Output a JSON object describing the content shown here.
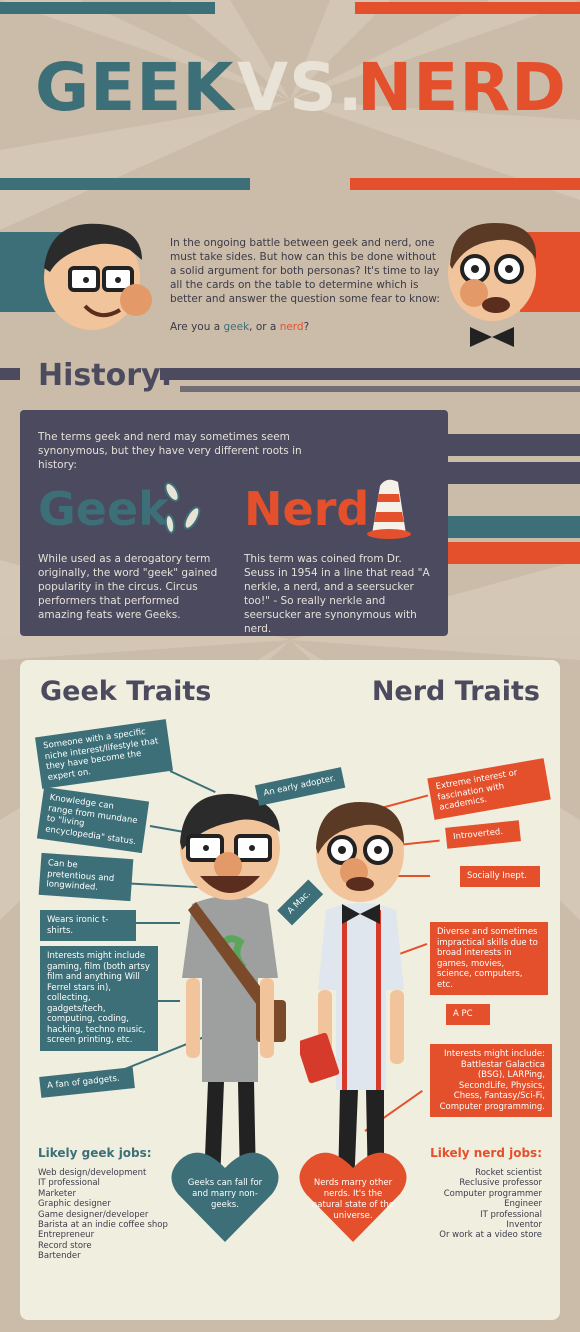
{
  "colors": {
    "teal": "#3c6f78",
    "orange": "#e4502b",
    "navy": "#4b4a5e",
    "beige": "#cbbca9",
    "cream": "#f0eedf"
  },
  "title": {
    "geek": "GEEK",
    "vs": "VS.",
    "nerd": "NERD"
  },
  "intro": {
    "paragraph": "In the ongoing battle between geek and nerd, one must take sides. But how can this be done without a solid argument for both personas? It's time to lay all the cards on the table to determine which is better and answer the question some fear to know:",
    "question_start": "Are you a ",
    "question_geek": "geek",
    "question_mid": ", or a ",
    "question_nerd": "nerd",
    "question_end": "?"
  },
  "history": {
    "heading": "History:",
    "intro": "The terms geek and nerd may sometimes seem synonymous, but they have very different roots in history:",
    "geek_word": "Geek",
    "geek_text": "While used as a derogatory term originally, the word \"geek\" gained popularity in the circus. Circus performers that performed amazing feats were Geeks.",
    "nerd_word": "Nerd",
    "nerd_text": "This term was coined from Dr. Seuss in 1954 in a line that read \"A nerkle, a nerd, and a seersucker too!\" - So really nerkle and seersucker are synonymous with nerd."
  },
  "traits": {
    "geek_heading": "Geek Traits",
    "nerd_heading": "Nerd Traits",
    "geek": [
      "Someone with a specific niche interest/lifestyle that they have become the expert on.",
      "An early adopter.",
      "Knowledge can range from mundane to \"living encyclopedia\" status.",
      "Can be pretentious and longwinded.",
      "A Mac.",
      "Wears ironic t-shirts.",
      "Interests might include gaming, film (both artsy film and anything Will Ferrel stars in), collecting, gadgets/tech, computing, coding, hacking, techno music, screen printing, etc.",
      "A fan of gadgets."
    ],
    "nerd": [
      "Extreme interest or fascination with academics.",
      "Introverted.",
      "Socially Inept.",
      "Diverse and sometimes impractical skills due to broad interests in games, movies, science, computers, etc.",
      "A PC",
      "Interests might include: Battlestar Galactica (BSG), LARPing, SecondLife, Physics, Chess, Fantasy/Sci-Fi, Computer programming."
    ]
  },
  "jobs": {
    "geek_heading": "Likely geek jobs:",
    "geek_list": [
      "Web design/development",
      "IT professional",
      "Marketer",
      "Graphic designer",
      "Game designer/developer",
      "Barista at an indie coffee shop",
      "Entrepreneur",
      "Record store",
      "Bartender"
    ],
    "nerd_heading": "Likely nerd jobs:",
    "nerd_list": [
      "Rocket scientist",
      "Reclusive professor",
      "Computer programmer",
      "Engineer",
      "IT professional",
      "Inventor",
      "Or work at a video store"
    ],
    "geek_heart": "Geeks can fall for and marry non-geeks.",
    "nerd_heart": "Nerds marry other nerds. It's the natural state of the universe."
  }
}
